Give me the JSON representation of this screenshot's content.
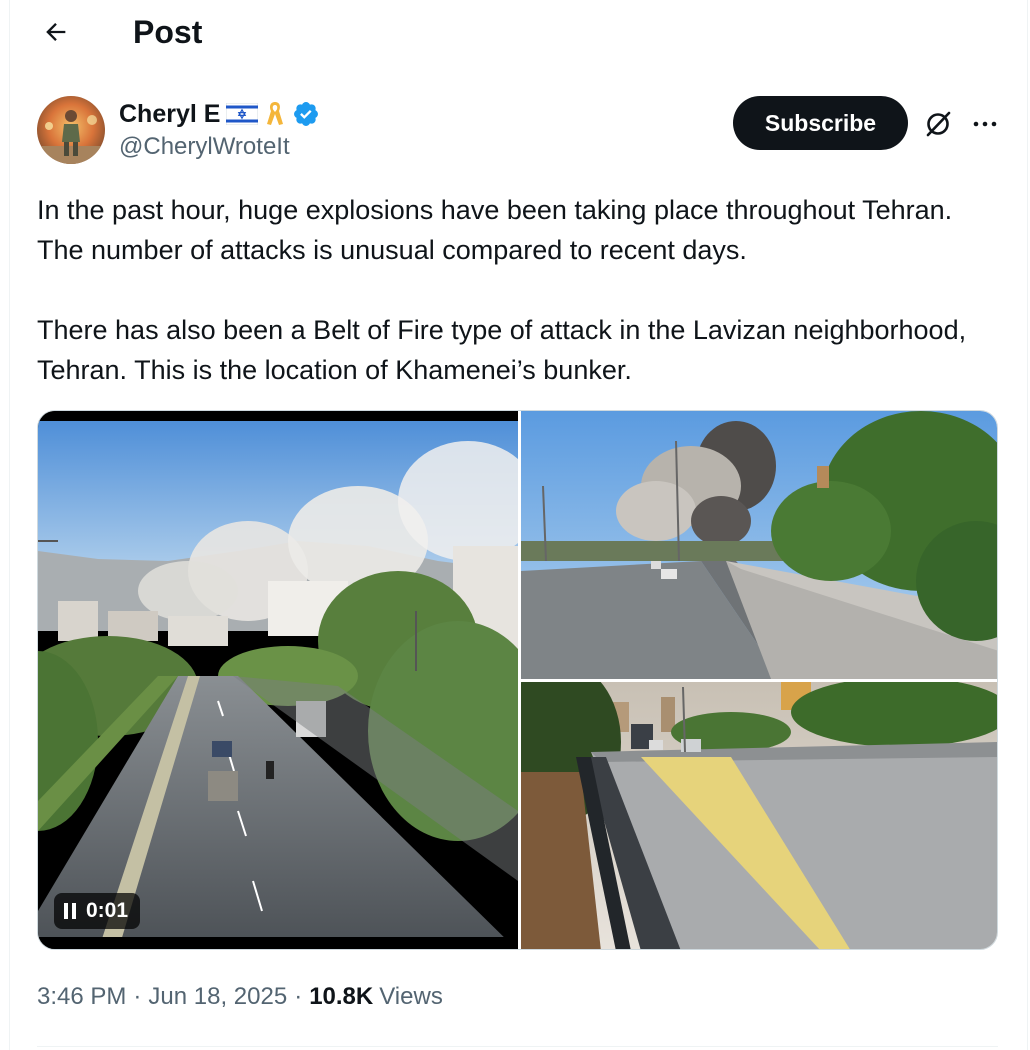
{
  "header": {
    "title": "Post",
    "back_icon": "arrow-left-icon"
  },
  "author": {
    "name": "Cheryl E",
    "handle": "@CherylWroteIt",
    "badges": [
      "israel-flag-icon",
      "yellow-ribbon-icon",
      "verified-badge-icon"
    ],
    "verified_color": "#1d9bf0"
  },
  "actions": {
    "subscribe_label": "Subscribe",
    "grok_icon": "grok-icon",
    "more_icon": "more-horizontal-icon"
  },
  "post": {
    "text": "In the past hour, huge explosions have been taking place throughout Tehran. The number of attacks is unusual compared to recent days.\n\nThere has also been a Belt of Fire type of attack in the Lavizan neighborhood, Tehran. This is the location of Khamenei’s bunker."
  },
  "media": {
    "video_time": "0:01",
    "video_state_icon": "pause-icon"
  },
  "meta": {
    "time": "3:46 PM",
    "date": "Jun 18, 2025",
    "views_count": "10.8K",
    "views_label": "Views"
  },
  "colors": {
    "text": "#0f1419",
    "secondary": "#536471",
    "button_bg": "#0f1419",
    "border": "#cfd9de"
  }
}
